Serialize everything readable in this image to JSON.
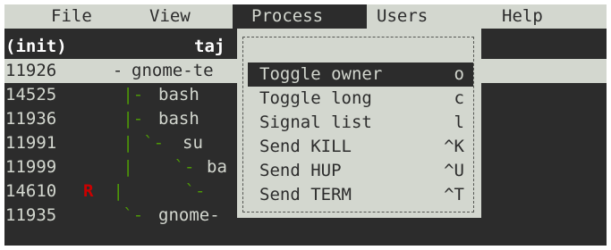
{
  "menubar": {
    "items": [
      {
        "label": "File"
      },
      {
        "label": "View"
      },
      {
        "label": "Process"
      },
      {
        "label": "Users"
      },
      {
        "label": "Help"
      }
    ]
  },
  "table": {
    "header": {
      "pid": "(init)",
      "user": "taj"
    },
    "rows": [
      {
        "pid": "11926",
        "flag": "",
        "tree": "  - ",
        "cmd": "gnome-te"
      },
      {
        "pid": "14525",
        "flag": "",
        "tree": "   |- ",
        "cmd": "bash"
      },
      {
        "pid": "11936",
        "flag": "",
        "tree": "   |- ",
        "cmd": "bash"
      },
      {
        "pid": "11991",
        "flag": "",
        "tree": "   | `- ",
        "cmd": "su"
      },
      {
        "pid": "11999",
        "flag": "",
        "tree": "   |    `- ",
        "cmd": "ba"
      },
      {
        "pid": "14610",
        "flag": "R",
        "tree": " |      `- ",
        "cmd": ""
      },
      {
        "pid": "11935",
        "flag": "",
        "tree": "   `- ",
        "cmd": "gnome-"
      }
    ]
  },
  "process_menu": {
    "items": [
      {
        "label": "Toggle owner",
        "shortcut": "o"
      },
      {
        "label": "Toggle long",
        "shortcut": "c"
      },
      {
        "label": "Signal list",
        "shortcut": "l"
      },
      {
        "label": "Send KILL",
        "shortcut": "^K"
      },
      {
        "label": "Send HUP",
        "shortcut": "^U"
      },
      {
        "label": "Send TERM",
        "shortcut": "^T"
      }
    ]
  },
  "colors": {
    "background": "#2c2c2c",
    "foreground": "#d3d7cf",
    "tree": "#4e9a06",
    "flag": "#cc0000"
  }
}
